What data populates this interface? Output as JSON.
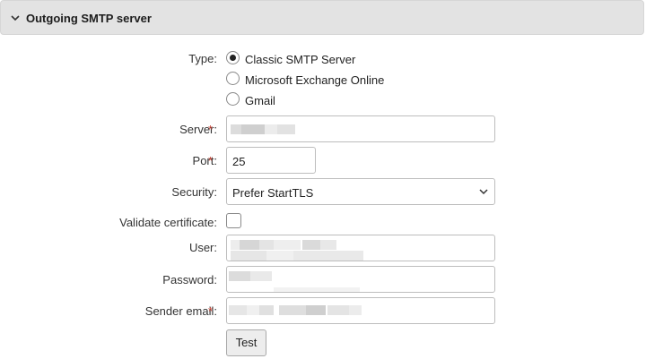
{
  "section": {
    "title": "Outgoing SMTP server",
    "icon": "chevron-down-icon"
  },
  "type": {
    "label": "Type:",
    "options": [
      {
        "label": "Classic SMTP Server",
        "checked": true
      },
      {
        "label": "Microsoft Exchange Online",
        "checked": false
      },
      {
        "label": "Gmail",
        "checked": false
      }
    ]
  },
  "server": {
    "label": "Server:",
    "required": "*",
    "value": ""
  },
  "port": {
    "label": "Port:",
    "required": "*",
    "value": "25"
  },
  "security": {
    "label": "Security:",
    "value": "Prefer StartTLS"
  },
  "validate": {
    "label": "Validate certificate:",
    "checked": false
  },
  "user": {
    "label": "User:",
    "value": ""
  },
  "password": {
    "label": "Password:",
    "value": ""
  },
  "sender": {
    "label": "Sender email:",
    "required": "*",
    "value": ""
  },
  "test_button": {
    "label": "Test"
  },
  "colors": {
    "header_bg": "#e3e3e3",
    "required_marker": "#c0392b"
  }
}
